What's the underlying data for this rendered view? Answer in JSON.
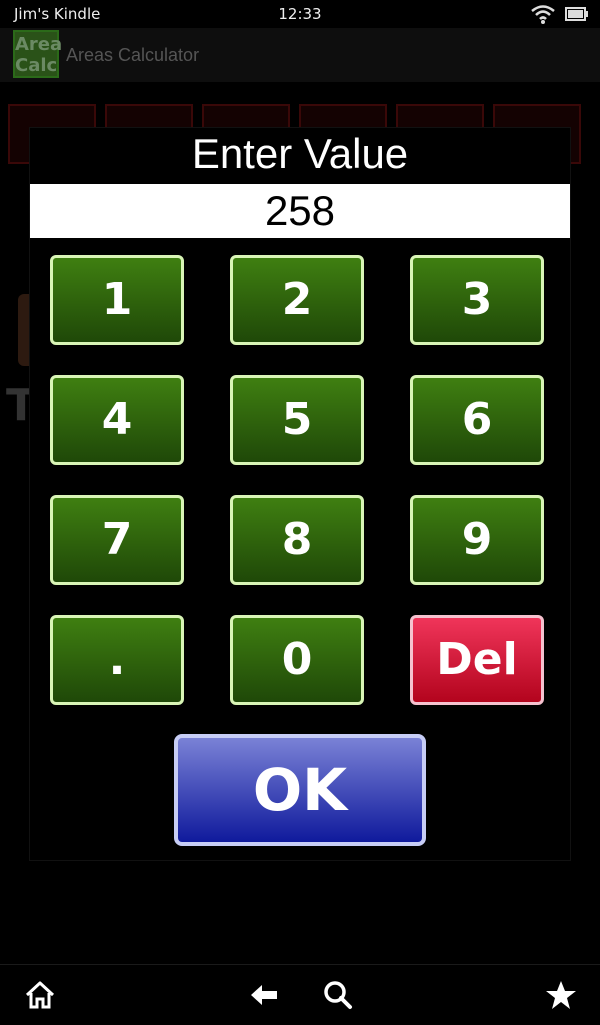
{
  "status_bar": {
    "device_name": "Jim's Kindle",
    "time": "12:33",
    "icons": [
      "wifi-icon",
      "battery-icon"
    ]
  },
  "app_bar": {
    "logo_line1": "Area",
    "logo_line2": "Calc",
    "title": "Areas Calculator"
  },
  "background": {
    "partial_text": "T"
  },
  "dialog": {
    "title": "Enter Value",
    "value": "258",
    "keys": [
      "1",
      "2",
      "3",
      "4",
      "5",
      "6",
      "7",
      "8",
      "9",
      ".",
      "0",
      "Del"
    ],
    "ok_label": "OK"
  },
  "nav_bar": {
    "icons": [
      "home-icon",
      "back-icon",
      "search-icon",
      "favorites-icon"
    ]
  },
  "colors": {
    "key_green": "#2f6410",
    "key_border": "#d9f5b6",
    "del_red": "#e3173c",
    "ok_blue": "#2a36b0"
  }
}
